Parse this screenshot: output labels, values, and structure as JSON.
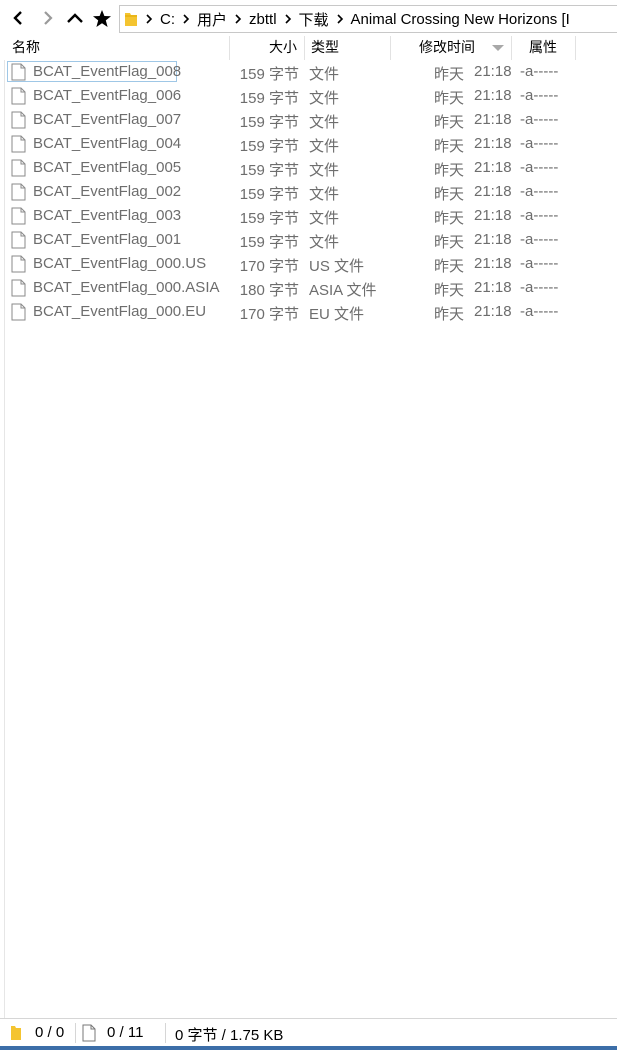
{
  "toolbar": {
    "back_icon": "chevron-left-icon",
    "forward_icon": "chevron-right-icon",
    "up_icon": "chevron-up-icon",
    "favorite_icon": "star-icon"
  },
  "breadcrumb": {
    "items": [
      "C:",
      "用户",
      "zbttl",
      "下载",
      "Animal Crossing New Horizons [I"
    ]
  },
  "columns": {
    "name": "名称",
    "size": "大小",
    "type": "类型",
    "modified": "修改时间",
    "attributes": "属性"
  },
  "files": [
    {
      "name": "BCAT_EventFlag_008",
      "size": "159 字节",
      "type": "文件",
      "date": "昨天",
      "time": "21:18",
      "attr": "-a-----"
    },
    {
      "name": "BCAT_EventFlag_006",
      "size": "159 字节",
      "type": "文件",
      "date": "昨天",
      "time": "21:18",
      "attr": "-a-----"
    },
    {
      "name": "BCAT_EventFlag_007",
      "size": "159 字节",
      "type": "文件",
      "date": "昨天",
      "time": "21:18",
      "attr": "-a-----"
    },
    {
      "name": "BCAT_EventFlag_004",
      "size": "159 字节",
      "type": "文件",
      "date": "昨天",
      "time": "21:18",
      "attr": "-a-----"
    },
    {
      "name": "BCAT_EventFlag_005",
      "size": "159 字节",
      "type": "文件",
      "date": "昨天",
      "time": "21:18",
      "attr": "-a-----"
    },
    {
      "name": "BCAT_EventFlag_002",
      "size": "159 字节",
      "type": "文件",
      "date": "昨天",
      "time": "21:18",
      "attr": "-a-----"
    },
    {
      "name": "BCAT_EventFlag_003",
      "size": "159 字节",
      "type": "文件",
      "date": "昨天",
      "time": "21:18",
      "attr": "-a-----"
    },
    {
      "name": "BCAT_EventFlag_001",
      "size": "159 字节",
      "type": "文件",
      "date": "昨天",
      "time": "21:18",
      "attr": "-a-----"
    },
    {
      "name": "BCAT_EventFlag_000.US",
      "size": "170 字节",
      "type": "US 文件",
      "date": "昨天",
      "time": "21:18",
      "attr": "-a-----"
    },
    {
      "name": "BCAT_EventFlag_000.ASIA",
      "size": "180 字节",
      "type": "ASIA 文件",
      "date": "昨天",
      "time": "21:18",
      "attr": "-a-----"
    },
    {
      "name": "BCAT_EventFlag_000.EU",
      "size": "170 字节",
      "type": "EU 文件",
      "date": "昨天",
      "time": "21:18",
      "attr": "-a-----"
    }
  ],
  "status": {
    "folders": "0 / 0",
    "files": "0 / 11",
    "size": "0 字节 / 1.75 KB"
  },
  "colors": {
    "folder": "#f4c430",
    "accent_bottom": "#3c6ea8",
    "file_text": "#6d6d6d"
  }
}
